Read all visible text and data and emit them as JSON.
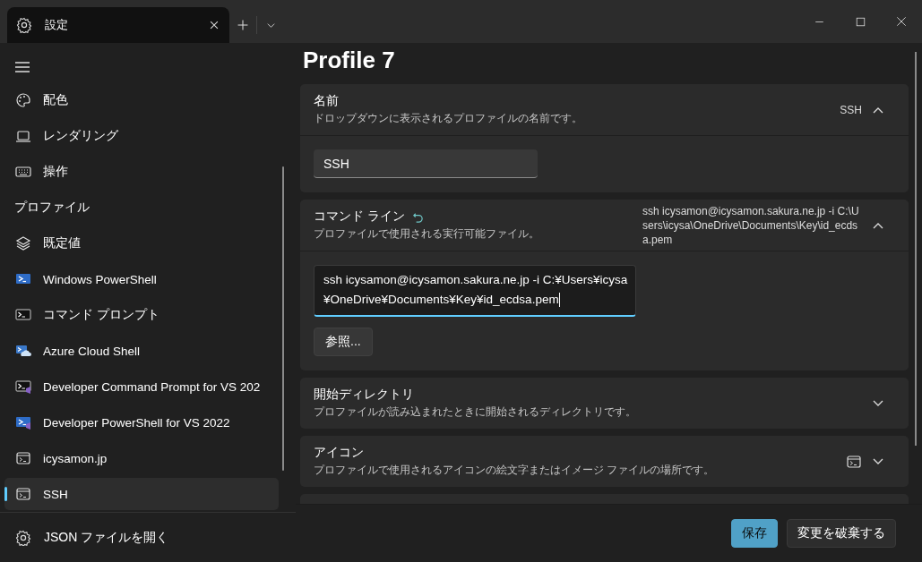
{
  "window": {
    "tab_title": "設定"
  },
  "sidebar": {
    "items": [
      {
        "kind": "item",
        "label": "配色",
        "selected": false
      },
      {
        "kind": "item",
        "label": "レンダリング",
        "selected": false
      },
      {
        "kind": "item",
        "label": "操作",
        "selected": false
      },
      {
        "kind": "header",
        "label": "プロファイル"
      },
      {
        "kind": "item",
        "label": "既定値",
        "selected": false
      },
      {
        "kind": "item",
        "label": "Windows PowerShell",
        "selected": false
      },
      {
        "kind": "item",
        "label": "コマンド プロンプト",
        "selected": false
      },
      {
        "kind": "item",
        "label": "Azure Cloud Shell",
        "selected": false
      },
      {
        "kind": "item",
        "label": "Developer Command Prompt for VS 202",
        "selected": false
      },
      {
        "kind": "item",
        "label": "Developer PowerShell for VS 2022",
        "selected": false
      },
      {
        "kind": "item",
        "label": "icysamon.jp",
        "selected": false
      },
      {
        "kind": "item",
        "label": "SSH",
        "selected": true
      }
    ],
    "footer_item": "JSON ファイルを開く"
  },
  "page_title": "Profile 7",
  "settings": [
    {
      "kind": "text",
      "title": "名前",
      "description": "ドロップダウンに表示されるプロファイルの名前です。",
      "summary": "SSH",
      "expanded": true,
      "modified": false,
      "value": "SSH"
    },
    {
      "kind": "command",
      "title": "コマンド ライン",
      "description": "プロファイルで使用される実行可能ファイル。",
      "summary": "ssh icysamon@icysamon.sakura.ne.jp -i C:\\Users\\icysa\\OneDrive\\Documents\\Key\\id_ecdsa.pem",
      "expanded": true,
      "modified": true,
      "value": "ssh icysamon@icysamon.sakura.ne.jp -i C:¥Users¥icysa¥OneDrive¥Documents¥Key¥id_ecdsa.pem",
      "browse_label": "参照..."
    },
    {
      "kind": "folder",
      "title": "開始ディレクトリ",
      "description": "プロファイルが読み込まれたときに開始されるディレクトリです。",
      "expanded": false,
      "modified": false
    },
    {
      "kind": "icon",
      "title": "アイコン",
      "description": "プロファイルで使用されるアイコンの絵文字またはイメージ ファイルの場所です。",
      "expanded": false,
      "modified": false
    }
  ],
  "footer_buttons": [
    {
      "label": "保存",
      "primary": true
    },
    {
      "label": "変更を破棄する",
      "primary": false
    }
  ]
}
